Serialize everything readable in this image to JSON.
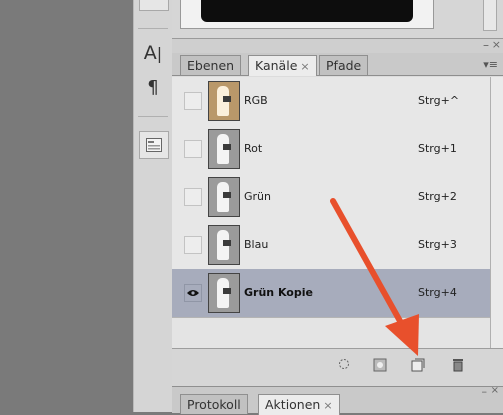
{
  "tools": [
    {
      "name": "character-panel-icon",
      "glyph": "A|"
    },
    {
      "name": "paragraph-panel-icon",
      "glyph": "¶"
    },
    {
      "name": "info-panel-icon",
      "glyph": "▤"
    }
  ],
  "channels_panel": {
    "tabs": [
      {
        "label": "Ebenen",
        "active": false,
        "closable": false
      },
      {
        "label": "Kanäle",
        "active": true,
        "closable": true
      },
      {
        "label": "Pfade",
        "active": false,
        "closable": false
      }
    ],
    "close_symbol": "×",
    "channels": [
      {
        "name": "RGB",
        "shortcut": "Strg+^",
        "visible": false,
        "selected": false
      },
      {
        "name": "Rot",
        "shortcut": "Strg+1",
        "visible": false,
        "selected": false
      },
      {
        "name": "Grün",
        "shortcut": "Strg+2",
        "visible": false,
        "selected": false
      },
      {
        "name": "Blau",
        "shortcut": "Strg+3",
        "visible": false,
        "selected": false
      },
      {
        "name": "Grün Kopie",
        "shortcut": "Strg+4",
        "visible": true,
        "selected": true
      }
    ],
    "footer_buttons": [
      {
        "name": "load-selection-icon",
        "glyph": "○"
      },
      {
        "name": "save-selection-icon",
        "glyph": "◙"
      },
      {
        "name": "new-channel-icon",
        "glyph": "⊡"
      },
      {
        "name": "delete-channel-icon",
        "glyph": "🗑"
      }
    ]
  },
  "bottom_panel": {
    "tabs": [
      {
        "label": "Protokoll",
        "active": false,
        "closable": false
      },
      {
        "label": "Aktionen",
        "active": true,
        "closable": true
      }
    ]
  },
  "annotation": {
    "color": "#e8502c"
  }
}
